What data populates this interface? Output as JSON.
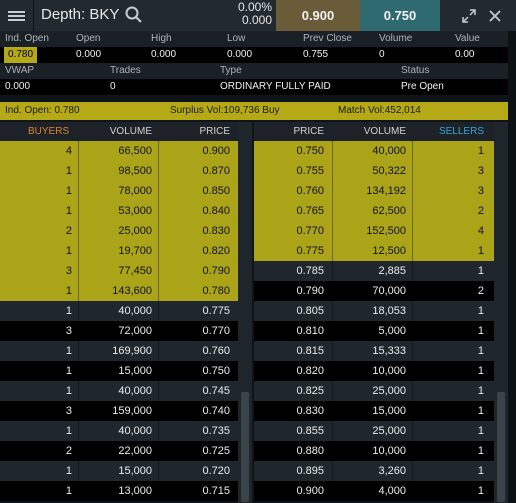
{
  "title": "Depth: BKY",
  "price_change": {
    "percent": "0.00%",
    "value": "0.000"
  },
  "best_bid": "0.900",
  "best_ask": "0.750",
  "icons": {
    "menu": "hamburger-menu-icon",
    "search": "search-icon",
    "expand": "expand-icon",
    "close": "close-icon"
  },
  "colors": {
    "buyer_highlight": "#aba318",
    "bid_box": "#6a5c38",
    "ask_box": "#2f6a70",
    "buyers_header": "#d9822b",
    "sellers_header": "#3aa3d8"
  },
  "stats": {
    "labels": [
      "Ind. Open",
      "Open",
      "High",
      "Low",
      "Prev Close",
      "Volume",
      "Value"
    ],
    "values": [
      "0.780",
      "0.000",
      "0.000",
      "0.000",
      "0.755",
      "0",
      "0.00"
    ],
    "labels2": [
      "VWAP",
      "Trades",
      "Type",
      "Status"
    ],
    "values2": [
      "0.000",
      "0",
      "ORDINARY FULLY PAID",
      "Pre Open"
    ]
  },
  "info": {
    "ind_open": "Ind. Open: 0.780",
    "surplus": "Surplus Vol:109,736 Buy",
    "match": "Match Vol:452,014"
  },
  "buy_headers": {
    "buyers": "BUYERS",
    "volume": "VOLUME",
    "price": "PRICE"
  },
  "sell_headers": {
    "price": "PRICE",
    "volume": "VOLUME",
    "sellers": "SELLERS"
  },
  "buys": [
    {
      "count": "4",
      "volume": "66,500",
      "price": "0.900"
    },
    {
      "count": "1",
      "volume": "98,500",
      "price": "0.870"
    },
    {
      "count": "1",
      "volume": "78,000",
      "price": "0.850"
    },
    {
      "count": "1",
      "volume": "53,000",
      "price": "0.840"
    },
    {
      "count": "2",
      "volume": "25,000",
      "price": "0.830"
    },
    {
      "count": "1",
      "volume": "19,700",
      "price": "0.820"
    },
    {
      "count": "3",
      "volume": "77,450",
      "price": "0.790"
    },
    {
      "count": "1",
      "volume": "143,600",
      "price": "0.780"
    },
    {
      "count": "1",
      "volume": "40,000",
      "price": "0.775"
    },
    {
      "count": "3",
      "volume": "72,000",
      "price": "0.770"
    },
    {
      "count": "1",
      "volume": "169,900",
      "price": "0.760"
    },
    {
      "count": "1",
      "volume": "15,000",
      "price": "0.750"
    },
    {
      "count": "1",
      "volume": "40,000",
      "price": "0.745"
    },
    {
      "count": "3",
      "volume": "159,000",
      "price": "0.740"
    },
    {
      "count": "1",
      "volume": "40,000",
      "price": "0.735"
    },
    {
      "count": "2",
      "volume": "22,000",
      "price": "0.725"
    },
    {
      "count": "1",
      "volume": "15,000",
      "price": "0.720"
    },
    {
      "count": "1",
      "volume": "13,000",
      "price": "0.715"
    }
  ],
  "sells": [
    {
      "price": "0.750",
      "volume": "40,000",
      "count": "1"
    },
    {
      "price": "0.755",
      "volume": "50,322",
      "count": "3"
    },
    {
      "price": "0.760",
      "volume": "134,192",
      "count": "3"
    },
    {
      "price": "0.765",
      "volume": "62,500",
      "count": "2"
    },
    {
      "price": "0.770",
      "volume": "152,500",
      "count": "4"
    },
    {
      "price": "0.775",
      "volume": "12,500",
      "count": "1"
    },
    {
      "price": "0.785",
      "volume": "2,885",
      "count": "1"
    },
    {
      "price": "0.790",
      "volume": "70,000",
      "count": "2"
    },
    {
      "price": "0.805",
      "volume": "18,053",
      "count": "1"
    },
    {
      "price": "0.810",
      "volume": "5,000",
      "count": "1"
    },
    {
      "price": "0.815",
      "volume": "15,333",
      "count": "1"
    },
    {
      "price": "0.820",
      "volume": "10,000",
      "count": "1"
    },
    {
      "price": "0.825",
      "volume": "25,000",
      "count": "1"
    },
    {
      "price": "0.830",
      "volume": "15,000",
      "count": "1"
    },
    {
      "price": "0.855",
      "volume": "25,000",
      "count": "1"
    },
    {
      "price": "0.880",
      "volume": "10,000",
      "count": "1"
    },
    {
      "price": "0.895",
      "volume": "3,260",
      "count": "1"
    },
    {
      "price": "0.900",
      "volume": "4,000",
      "count": "1"
    }
  ]
}
